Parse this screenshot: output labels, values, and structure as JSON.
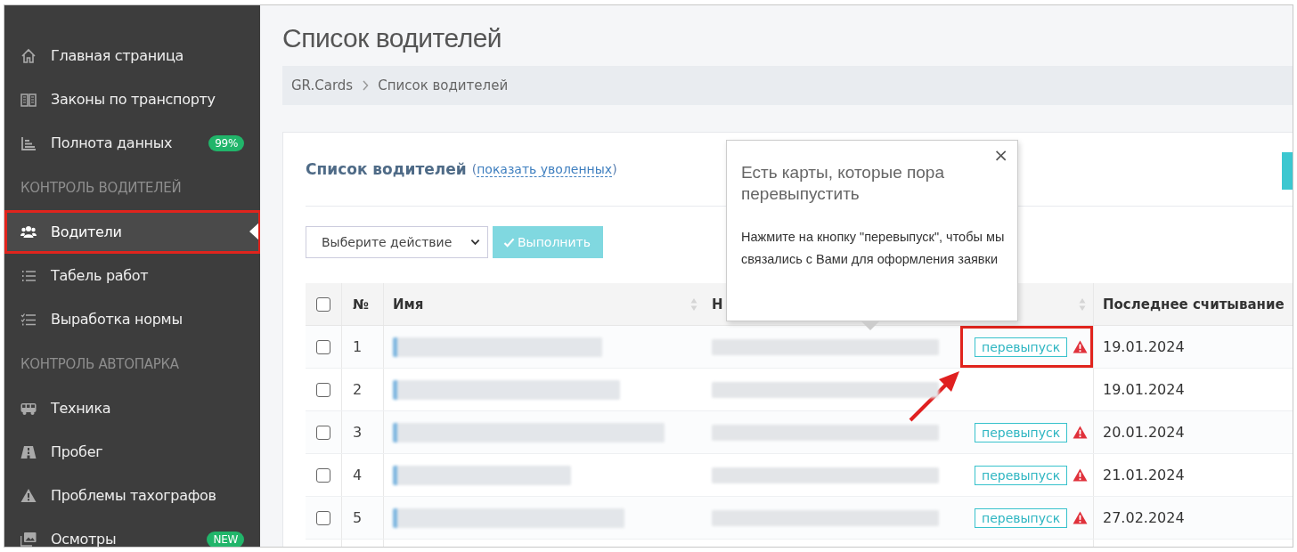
{
  "sidebar": {
    "items": [
      {
        "kind": "item",
        "label": "Главная страница",
        "selected": false,
        "highlighted": false
      },
      {
        "kind": "item",
        "label": "Законы по транспорту",
        "selected": false,
        "highlighted": false
      },
      {
        "kind": "item",
        "label": "Полнота данных",
        "badge": "99%",
        "selected": false,
        "highlighted": false
      },
      {
        "kind": "header",
        "label": "КОНТРОЛЬ ВОДИТЕЛЕЙ"
      },
      {
        "kind": "item",
        "label": "Водители",
        "selected": true,
        "highlighted": true
      },
      {
        "kind": "item",
        "label": "Табель работ",
        "selected": false,
        "highlighted": false
      },
      {
        "kind": "item",
        "label": "Выработка нормы",
        "selected": false,
        "highlighted": false
      },
      {
        "kind": "header",
        "label": "КОНТРОЛЬ АВТОПАРКА"
      },
      {
        "kind": "item",
        "label": "Техника",
        "selected": false,
        "highlighted": false
      },
      {
        "kind": "item",
        "label": "Пробег",
        "selected": false,
        "highlighted": false
      },
      {
        "kind": "item",
        "label": "Проблемы тахографов",
        "selected": false,
        "highlighted": false
      },
      {
        "kind": "item",
        "label": "Осмотры",
        "badge": "NEW",
        "selected": false,
        "highlighted": false
      }
    ]
  },
  "page_title": "Список водителей",
  "breadcrumb": [
    "GR.Cards",
    "Список водителей"
  ],
  "card": {
    "title": "Список водителей",
    "link_open": "(",
    "link": "показать уволенных",
    "link_close": ")",
    "action_select": "Выберите действие",
    "run_button": "Выполнить",
    "table": {
      "all_checked": false,
      "columns": [
        "№",
        "Имя",
        "Н",
        "",
        "Последнее считывание"
      ],
      "rows": [
        {
          "checked": false,
          "number": "1",
          "reissue": "перевыпуск",
          "highlighted": true,
          "last_read": "19.01.2024"
        },
        {
          "checked": false,
          "number": "2",
          "highlighted": false,
          "last_read": "19.01.2024"
        },
        {
          "checked": false,
          "number": "3",
          "reissue": "перевыпуск",
          "highlighted": false,
          "last_read": "20.01.2024"
        },
        {
          "checked": false,
          "number": "4",
          "reissue": "перевыпуск",
          "highlighted": false,
          "last_read": "21.01.2024"
        },
        {
          "checked": false,
          "number": "5",
          "reissue": "перевыпуск",
          "highlighted": false,
          "last_read": "27.02.2024"
        }
      ]
    }
  },
  "popover": {
    "title": "Есть карты, которые пора перевыпустить",
    "text": "Нажмите на кнопку \"перевыпуск\", чтобы мы связались с Вами для оформления заявки",
    "close": "×"
  }
}
